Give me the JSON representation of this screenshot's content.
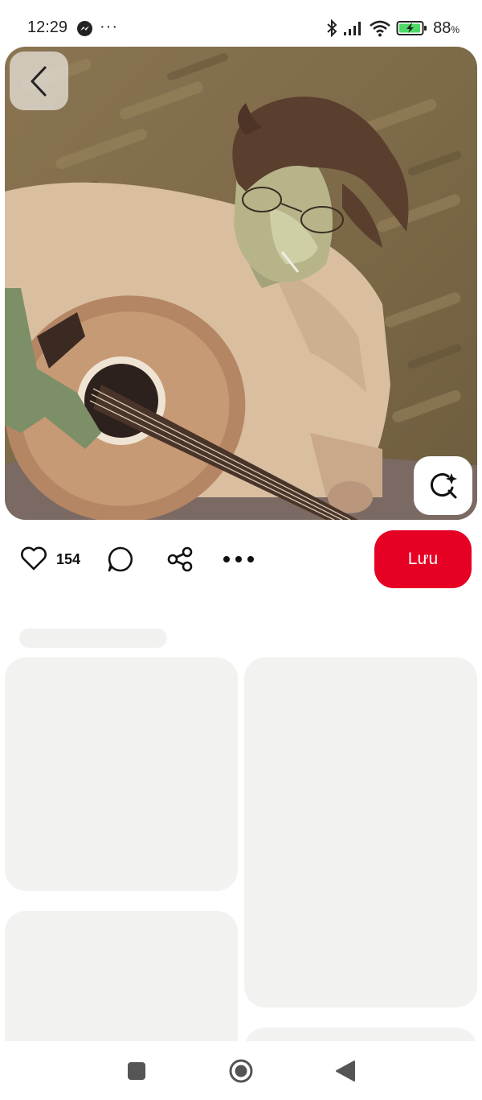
{
  "status_bar": {
    "time": "12:29",
    "more": "···",
    "battery_level": "88",
    "battery_unit": "%",
    "icons": [
      "messenger-icon",
      "bluetooth-icon",
      "signal-icon",
      "wifi-icon",
      "battery-charging-icon"
    ]
  },
  "pin": {
    "image_description": "illustration",
    "like_count": "154",
    "save_label": "Lưu"
  },
  "icons": {
    "back": "chevron-left-icon",
    "visual_search": "sparkle-search-icon",
    "like": "heart-icon",
    "comment": "comment-icon",
    "share": "share-icon",
    "more": "more-horizontal-icon"
  },
  "nav": [
    "recents-button",
    "home-button",
    "back-button"
  ],
  "colors": {
    "save_button": "#e60023",
    "skeleton": "#f2f2f1"
  }
}
